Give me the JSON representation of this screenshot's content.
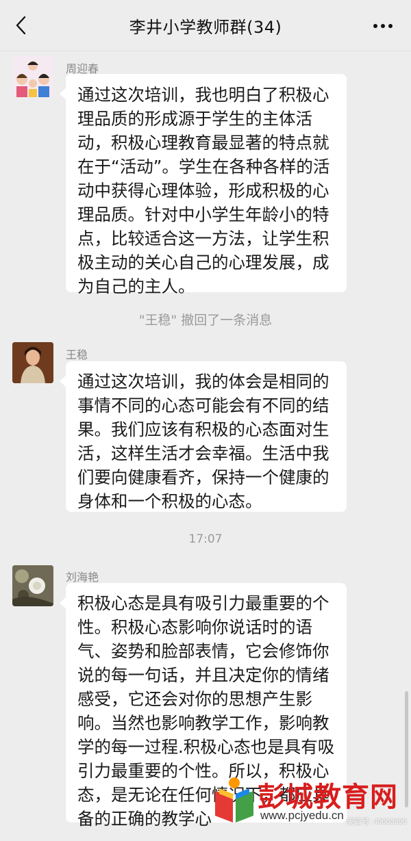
{
  "header": {
    "title": "李井小学教师群(34)",
    "back_icon": "back-arrow-icon",
    "more_icon": "more-dots-icon"
  },
  "messages": [
    {
      "sender": "周迎春",
      "lines": [
        "通过这次培训，我也明白了积极心",
        "理品质的形成源于学生的主体活",
        "动，积极心理教育最显著的特点就",
        "在于“活动”。学生在各种各样的活",
        "动中获得心理体验，形成积极的心",
        "理品质。针对中小学生年龄小的特",
        "点，比较适合这一方法，让学生积",
        "极主动的关心自己的心理发展，成",
        "为自己的主人。"
      ]
    },
    {
      "sender": "王稳",
      "lines": [
        "通过这次培训，我的体会是相同的",
        "事情不同的心态可能会有不同的结",
        "果。我们应该有积极的心态面对生",
        "活，这样生活才会幸福。生活中我",
        "们要向健康看齐，保持一个健康的",
        "身体和一个积极的心态。"
      ]
    },
    {
      "sender": "刘海艳",
      "lines": [
        "积极心态是具有吸引力最重要的个",
        "性。积极心态影响你说话时的语",
        "气、姿势和脸部表情，它会修饰你",
        "说的每一句话，并且决定你的情绪",
        "感受，它还会对你的思想产生影",
        "响。当然也影响教学工作，影响教",
        "学的每一过程.积极心态也是具有吸",
        "引力最重要的个性。所以，积极心",
        "态，是无论在任何情况下，都应具",
        "备的正确的教学心"
      ]
    }
  ],
  "system_notice": "\"王稳\" 撤回了一条消息",
  "timestamp": "17:07",
  "watermark": {
    "name": "彭城教育网",
    "url": "www.pcjyedu.cn",
    "id_text": "美篇号: 40603395"
  },
  "colors": {
    "background": "#ededed",
    "bubble": "#ffffff",
    "watermark_red": "#d81e1e"
  }
}
